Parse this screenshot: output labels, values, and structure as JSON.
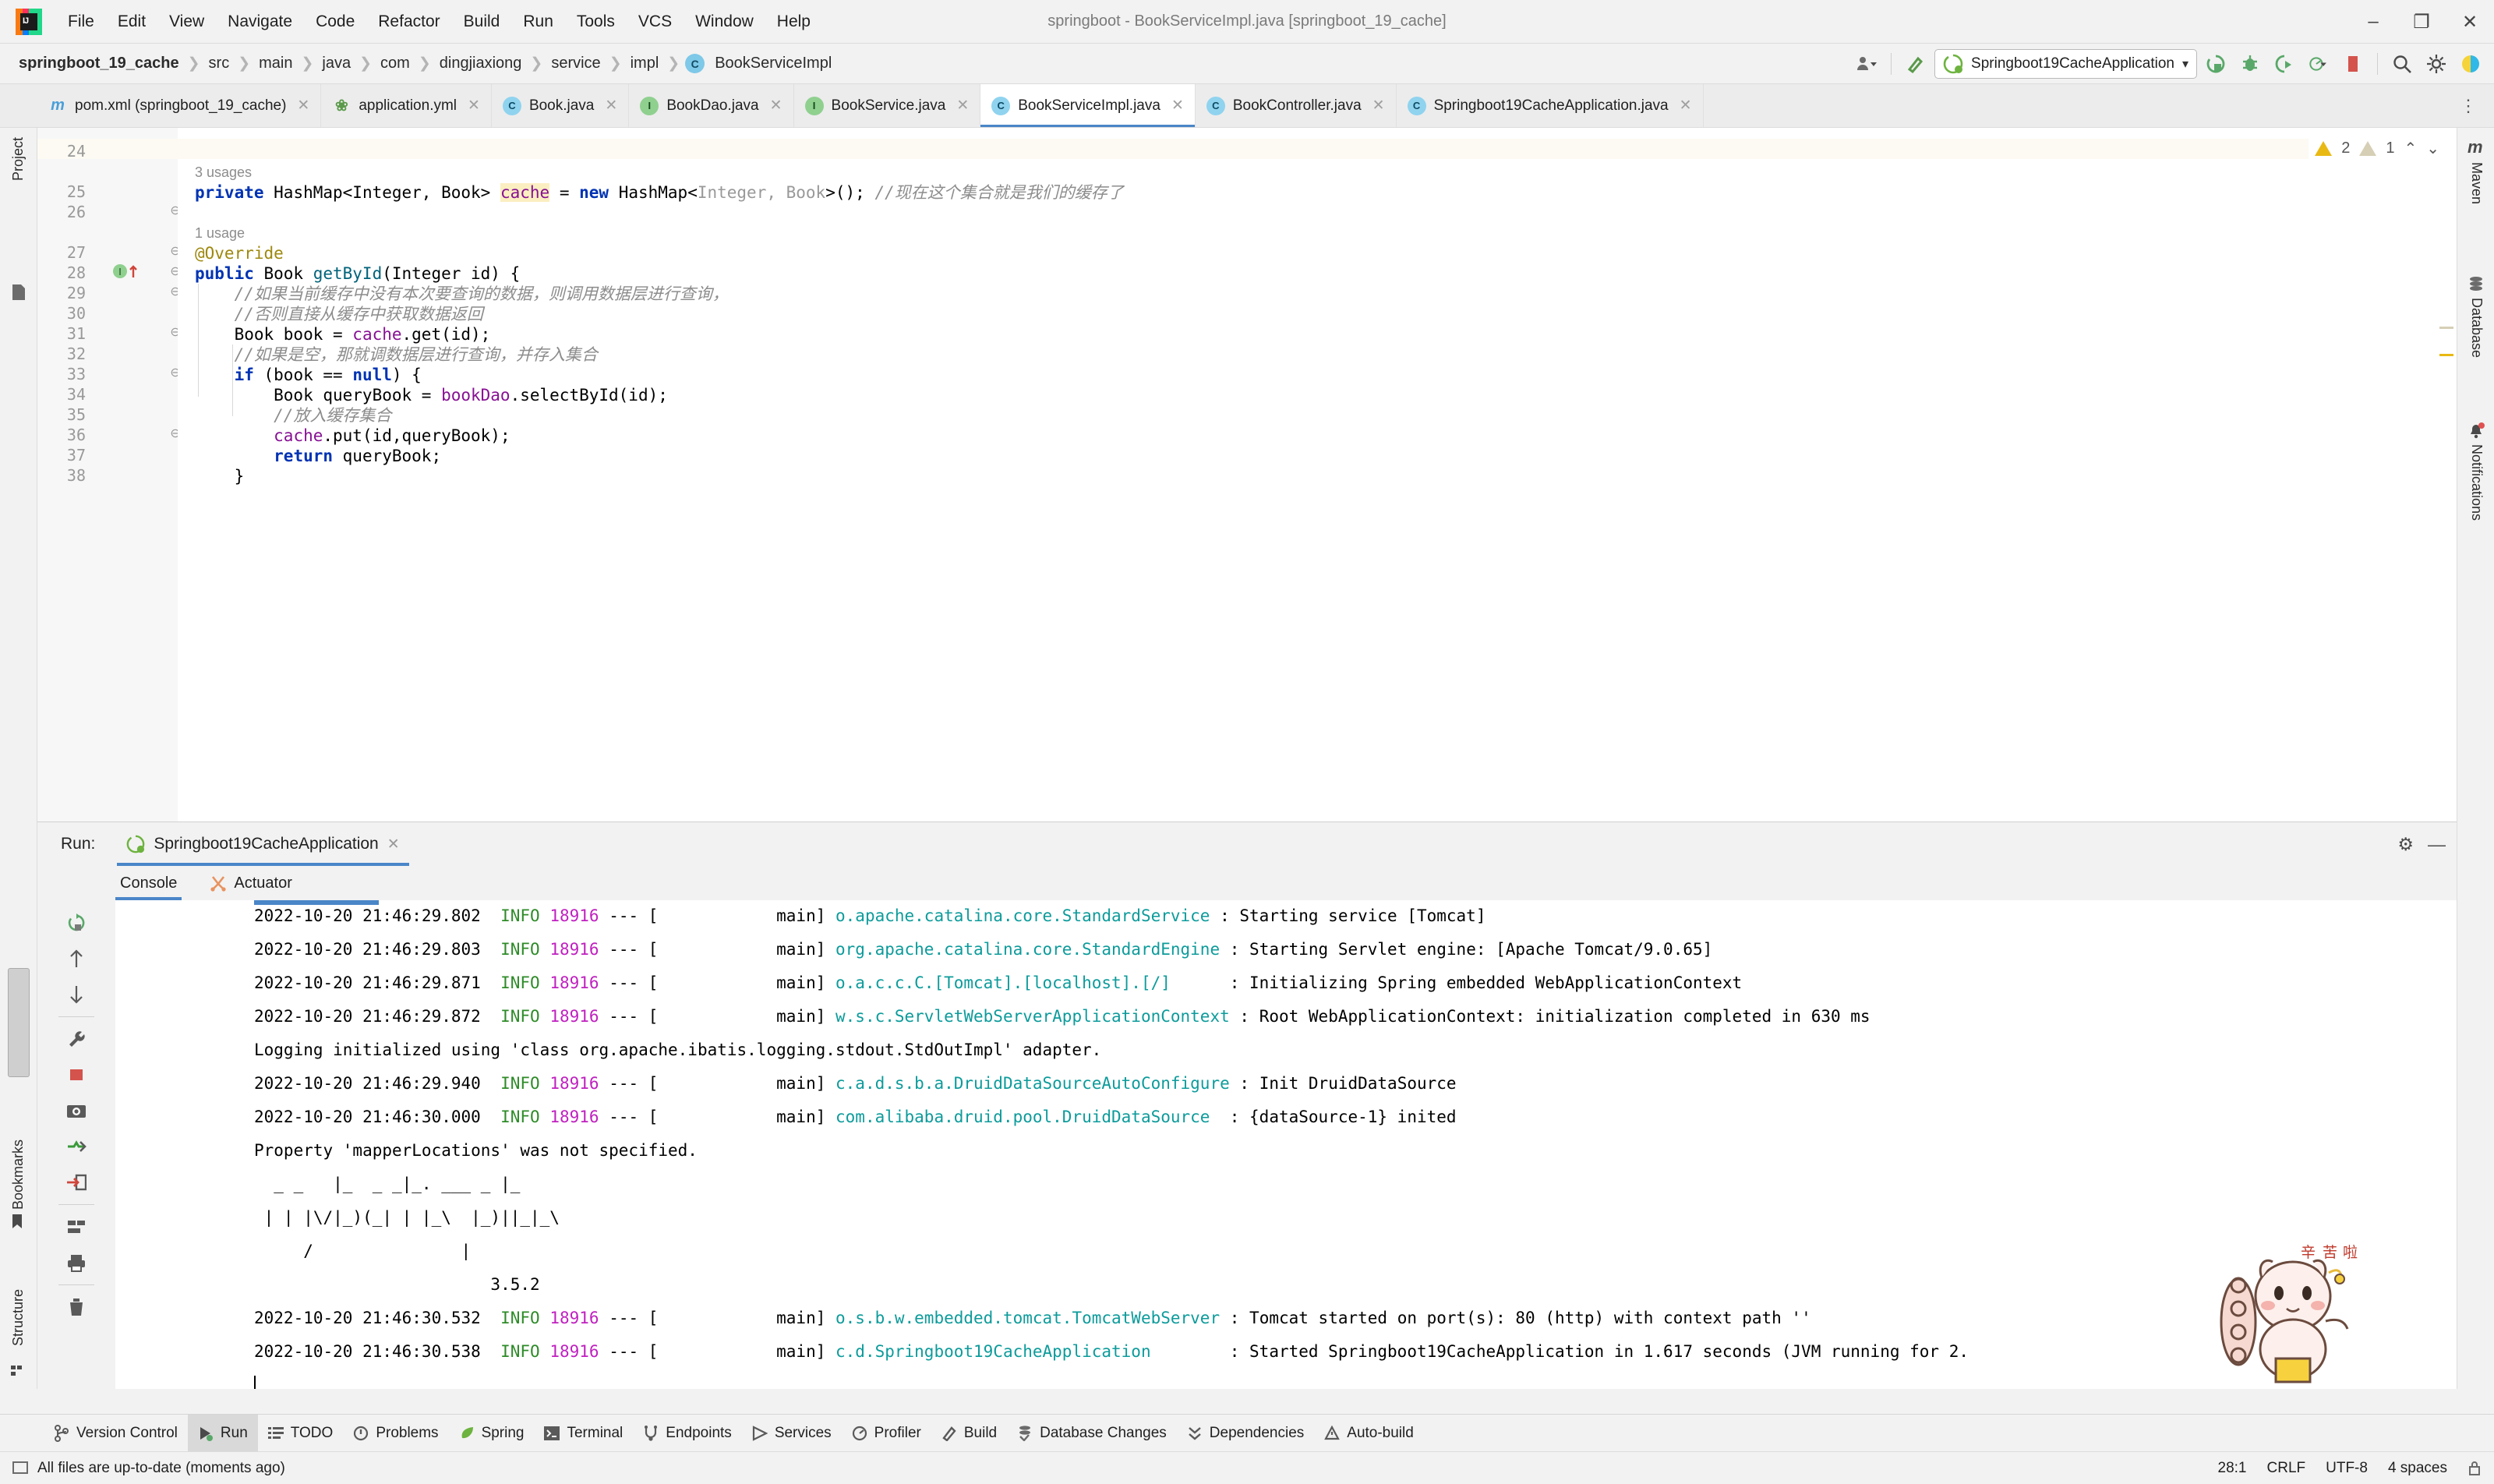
{
  "window": {
    "title": "springboot - BookServiceImpl.java [springboot_19_cache]",
    "minimize": "–",
    "maximize": "❐",
    "close": "✕"
  },
  "menu": [
    {
      "label": "File"
    },
    {
      "label": "Edit"
    },
    {
      "label": "View"
    },
    {
      "label": "Navigate"
    },
    {
      "label": "Code"
    },
    {
      "label": "Refactor"
    },
    {
      "label": "Build"
    },
    {
      "label": "Run"
    },
    {
      "label": "Tools"
    },
    {
      "label": "VCS"
    },
    {
      "label": "Window"
    },
    {
      "label": "Help"
    }
  ],
  "breadcrumb": {
    "items": [
      "springboot_19_cache",
      "src",
      "main",
      "java",
      "com",
      "dingjiaxiong",
      "service",
      "impl"
    ],
    "class_badge": "C",
    "class_name": "BookServiceImpl",
    "separator": "❯"
  },
  "toolbar": {
    "run_config": "Springboot19CacheApplication",
    "dropdown_caret": "▾",
    "icons": [
      {
        "name": "user-dropdown-icon",
        "glyph": "👤"
      },
      {
        "name": "build-hammer-icon",
        "glyph": "⚒"
      },
      {
        "name": "run-icon",
        "glyph": "▶"
      },
      {
        "name": "debug-icon",
        "glyph": "🐞"
      },
      {
        "name": "run-with-coverage-icon",
        "glyph": "▶"
      },
      {
        "name": "profile-icon",
        "glyph": "◔"
      },
      {
        "name": "stop-icon",
        "glyph": "■"
      },
      {
        "name": "search-icon",
        "glyph": "🔍"
      },
      {
        "name": "settings-gear-icon",
        "glyph": "⚙"
      },
      {
        "name": "help-icon",
        "glyph": "◖"
      }
    ]
  },
  "tabs": [
    {
      "label": "pom.xml (springboot_19_cache)",
      "icon": "maven-icon",
      "icon_glyph": "m",
      "icon_class": "m",
      "active": false
    },
    {
      "label": "application.yml",
      "icon": "yaml-spring-icon",
      "icon_glyph": "❀",
      "icon_class": "yml",
      "active": false
    },
    {
      "label": "Book.java",
      "icon": "class-icon",
      "icon_glyph": "C",
      "icon_class": "c",
      "active": false
    },
    {
      "label": "BookDao.java",
      "icon": "interface-icon",
      "icon_glyph": "I",
      "icon_class": "i",
      "active": false
    },
    {
      "label": "BookService.java",
      "icon": "interface-icon",
      "icon_glyph": "I",
      "icon_class": "i",
      "active": false
    },
    {
      "label": "BookServiceImpl.java",
      "icon": "class-icon",
      "icon_glyph": "C",
      "icon_class": "c",
      "active": true
    },
    {
      "label": "BookController.java",
      "icon": "class-icon",
      "icon_glyph": "C",
      "icon_class": "c",
      "active": false
    },
    {
      "label": "Springboot19CacheApplication.java",
      "icon": "spring-boot-class-icon",
      "icon_glyph": "C",
      "icon_class": "c",
      "active": false
    }
  ],
  "tab_close_glyph": "✕",
  "tabbar_overflow": "⋮",
  "editor": {
    "inspections": {
      "warning_count": "2",
      "weak_warning_count": "1",
      "up_arrow": "⌃",
      "down_arrow": "⌄"
    },
    "lines": [
      {
        "num": "24",
        "segments": [],
        "current": true
      },
      {
        "num": "",
        "hint": "3 usages"
      },
      {
        "num": "25",
        "segments": [
          {
            "t": "private",
            "c": "kw"
          },
          {
            "t": " HashMap<Integer, Book> ",
            "c": ""
          },
          {
            "t": "cache",
            "c": "fld hl"
          },
          {
            "t": " = ",
            "c": ""
          },
          {
            "t": "new",
            "c": "kw"
          },
          {
            "t": " HashMap<",
            "c": ""
          },
          {
            "t": "Integer, Book",
            "c": "gry"
          },
          {
            "t": ">(); ",
            "c": ""
          },
          {
            "t": "//现在这个集合就是我们的缓存了",
            "c": "cmt"
          }
        ]
      },
      {
        "num": "26",
        "segments": []
      },
      {
        "num": "",
        "hint": "1 usage"
      },
      {
        "num": "27",
        "segments": [
          {
            "t": "@Override",
            "c": "anno"
          }
        ]
      },
      {
        "num": "28",
        "segments": [
          {
            "t": "public",
            "c": "kw"
          },
          {
            "t": " Book ",
            "c": ""
          },
          {
            "t": "getById",
            "c": "mth"
          },
          {
            "t": "(Integer id) {",
            "c": ""
          }
        ]
      },
      {
        "num": "29",
        "segments": [
          {
            "t": "    //如果当前缓存中没有本次要查询的数据，则调用数据层进行查询，",
            "c": "cmt"
          }
        ]
      },
      {
        "num": "30",
        "segments": [
          {
            "t": "    //否则直接从缓存中获取数据返回",
            "c": "cmt"
          }
        ]
      },
      {
        "num": "31",
        "segments": [
          {
            "t": "    Book book = ",
            "c": ""
          },
          {
            "t": "cache",
            "c": "fld"
          },
          {
            "t": ".get(id);",
            "c": ""
          }
        ]
      },
      {
        "num": "32",
        "segments": [
          {
            "t": "    //如果是空，那就调数据层进行查询，并存入集合",
            "c": "cmt"
          }
        ]
      },
      {
        "num": "33",
        "segments": [
          {
            "t": "    ",
            "c": ""
          },
          {
            "t": "if",
            "c": "kw"
          },
          {
            "t": " (book == ",
            "c": ""
          },
          {
            "t": "null",
            "c": "kw"
          },
          {
            "t": ") {",
            "c": ""
          }
        ]
      },
      {
        "num": "34",
        "segments": [
          {
            "t": "        Book queryBook = ",
            "c": ""
          },
          {
            "t": "bookDao",
            "c": "fld"
          },
          {
            "t": ".selectById(id);",
            "c": ""
          }
        ]
      },
      {
        "num": "35",
        "segments": [
          {
            "t": "        //放入缓存集合",
            "c": "cmt"
          }
        ]
      },
      {
        "num": "36",
        "segments": [
          {
            "t": "        ",
            "c": ""
          },
          {
            "t": "cache",
            "c": "fld"
          },
          {
            "t": ".put(id,queryBook);",
            "c": ""
          }
        ]
      },
      {
        "num": "37",
        "segments": [
          {
            "t": "        ",
            "c": ""
          },
          {
            "t": "return",
            "c": "kw"
          },
          {
            "t": " queryBook;",
            "c": ""
          }
        ]
      },
      {
        "num": "38",
        "segments": [
          {
            "t": "    }",
            "c": ""
          }
        ]
      }
    ]
  },
  "run_panel": {
    "label": "Run:",
    "tab_name": "Springboot19CacheApplication",
    "tab_close": "✕",
    "settings_icon": "⚙",
    "minimize_icon": "—",
    "console_tabs": [
      {
        "label": "Console",
        "active": true
      },
      {
        "label": "Actuator",
        "active": false
      }
    ],
    "tool_buttons": [
      {
        "name": "rerun-icon",
        "glyph": "↻"
      },
      {
        "name": "scroll-up-icon",
        "glyph": "↑"
      },
      {
        "name": "scroll-down-icon",
        "glyph": "↓"
      },
      {
        "name": "settings-wrench-icon",
        "glyph": "🔧"
      },
      {
        "name": "stop-icon",
        "glyph": "■"
      },
      {
        "name": "screenshot-camera-icon",
        "glyph": "📷"
      },
      {
        "name": "thread-dump-icon",
        "glyph": "✇"
      },
      {
        "name": "export-icon",
        "glyph": "→"
      },
      {
        "name": "soft-wrap-icon",
        "glyph": "≣"
      },
      {
        "name": "print-icon",
        "glyph": "🖨"
      },
      {
        "name": "clear-all-icon",
        "glyph": "🗑"
      }
    ],
    "log_lines": [
      {
        "type": "log",
        "ts": "2022-10-20 21:46:29.802",
        "level": "INFO",
        "pid": "18916",
        "sep": "--- [",
        "thread": "            main]",
        "logger": "o.apache.catalina.core.StandardService",
        "logger_pad": 38,
        "msg": ": Starting service [Tomcat]"
      },
      {
        "type": "log",
        "ts": "2022-10-20 21:46:29.803",
        "level": "INFO",
        "pid": "18916",
        "sep": "--- [",
        "thread": "            main]",
        "logger": "org.apache.catalina.core.StandardEngine",
        "logger_pad": 39,
        "msg": ": Starting Servlet engine: [Apache Tomcat/9.0.65]"
      },
      {
        "type": "log",
        "ts": "2022-10-20 21:46:29.871",
        "level": "INFO",
        "pid": "18916",
        "sep": "--- [",
        "thread": "            main]",
        "logger": "o.a.c.c.C.[Tomcat].[localhost].[/]",
        "logger_pad": 39,
        "msg": ": Initializing Spring embedded WebApplicationContext"
      },
      {
        "type": "log",
        "ts": "2022-10-20 21:46:29.872",
        "level": "INFO",
        "pid": "18916",
        "sep": "--- [",
        "thread": "            main]",
        "logger": "w.s.c.ServletWebServerApplicationContext",
        "logger_pad": 39,
        "msg": ": Root WebApplicationContext: initialization completed in 630 ms"
      },
      {
        "type": "plain",
        "text": "Logging initialized using 'class org.apache.ibatis.logging.stdout.StdOutImpl' adapter."
      },
      {
        "type": "log",
        "ts": "2022-10-20 21:46:29.940",
        "level": "INFO",
        "pid": "18916",
        "sep": "--- [",
        "thread": "            main]",
        "logger": "c.a.d.s.b.a.DruidDataSourceAutoConfigure",
        "logger_pad": 39,
        "msg": ": Init DruidDataSource"
      },
      {
        "type": "log",
        "ts": "2022-10-20 21:46:30.000",
        "level": "INFO",
        "pid": "18916",
        "sep": "--- [",
        "thread": "            main]",
        "logger": "com.alibaba.druid.pool.DruidDataSource",
        "logger_pad": 39,
        "msg": ": {dataSource-1} inited"
      },
      {
        "type": "plain",
        "text": "Property 'mapperLocations' was not specified."
      },
      {
        "type": "plain",
        "text": "  _ _   |_  _ _|_. ___ _ |_"
      },
      {
        "type": "plain",
        "text": " | | |\\/|_)(_| | |_\\  |_)||_|_\\"
      },
      {
        "type": "plain",
        "text": "     /               |"
      },
      {
        "type": "plain",
        "text": "                        3.5.2"
      },
      {
        "type": "log",
        "ts": "2022-10-20 21:46:30.532",
        "level": "INFO",
        "pid": "18916",
        "sep": "--- [",
        "thread": "            main]",
        "logger": "o.s.b.w.embedded.tomcat.TomcatWebServer",
        "logger_pad": 39,
        "msg": ": Tomcat started on port(s): 80 (http) with context path ''"
      },
      {
        "type": "log",
        "ts": "2022-10-20 21:46:30.538",
        "level": "INFO",
        "pid": "18916",
        "sep": "--- [",
        "thread": "            main]",
        "logger": "c.d.Springboot19CacheApplication",
        "logger_pad": 39,
        "msg": ": Started Springboot19CacheApplication in 1.617 seconds (JVM running for 2."
      }
    ]
  },
  "left_strip": {
    "project_label": "Project",
    "bookmarks_label": "Bookmarks",
    "structure_label": "Structure"
  },
  "right_strip": {
    "maven_label": "Maven",
    "maven_icon": "m",
    "database_label": "Database",
    "notifications_label": "Notifications"
  },
  "tool_windows": [
    {
      "label": "Version Control",
      "icon": "branch-icon",
      "glyph": "⑂",
      "active": false
    },
    {
      "label": "Run",
      "icon": "run-icon",
      "glyph": "▶",
      "active": true
    },
    {
      "label": "TODO",
      "icon": "todo-list-icon",
      "glyph": "☰",
      "active": false
    },
    {
      "label": "Problems",
      "icon": "problems-icon",
      "glyph": "⊘",
      "active": false
    },
    {
      "label": "Spring",
      "icon": "spring-leaf-icon",
      "glyph": "❀",
      "active": false
    },
    {
      "label": "Terminal",
      "icon": "terminal-icon",
      "glyph": "⌨",
      "active": false
    },
    {
      "label": "Endpoints",
      "icon": "endpoints-icon",
      "glyph": "⑂",
      "active": false
    },
    {
      "label": "Services",
      "icon": "services-icon",
      "glyph": "▷",
      "active": false
    },
    {
      "label": "Profiler",
      "icon": "profiler-icon",
      "glyph": "◔",
      "active": false
    },
    {
      "label": "Build",
      "icon": "build-hammer-icon",
      "glyph": "⚒",
      "active": false
    },
    {
      "label": "Database Changes",
      "icon": "database-changes-icon",
      "glyph": "☰",
      "active": false
    },
    {
      "label": "Dependencies",
      "icon": "dependencies-icon",
      "glyph": "»",
      "active": false
    },
    {
      "label": "Auto-build",
      "icon": "auto-build-icon",
      "glyph": "⚠",
      "active": false
    }
  ],
  "status_bar": {
    "message": "All files are up-to-date (moments ago)",
    "caret_position": "28:1",
    "line_separator": "CRLF",
    "encoding": "UTF-8",
    "indent": "4 spaces"
  }
}
